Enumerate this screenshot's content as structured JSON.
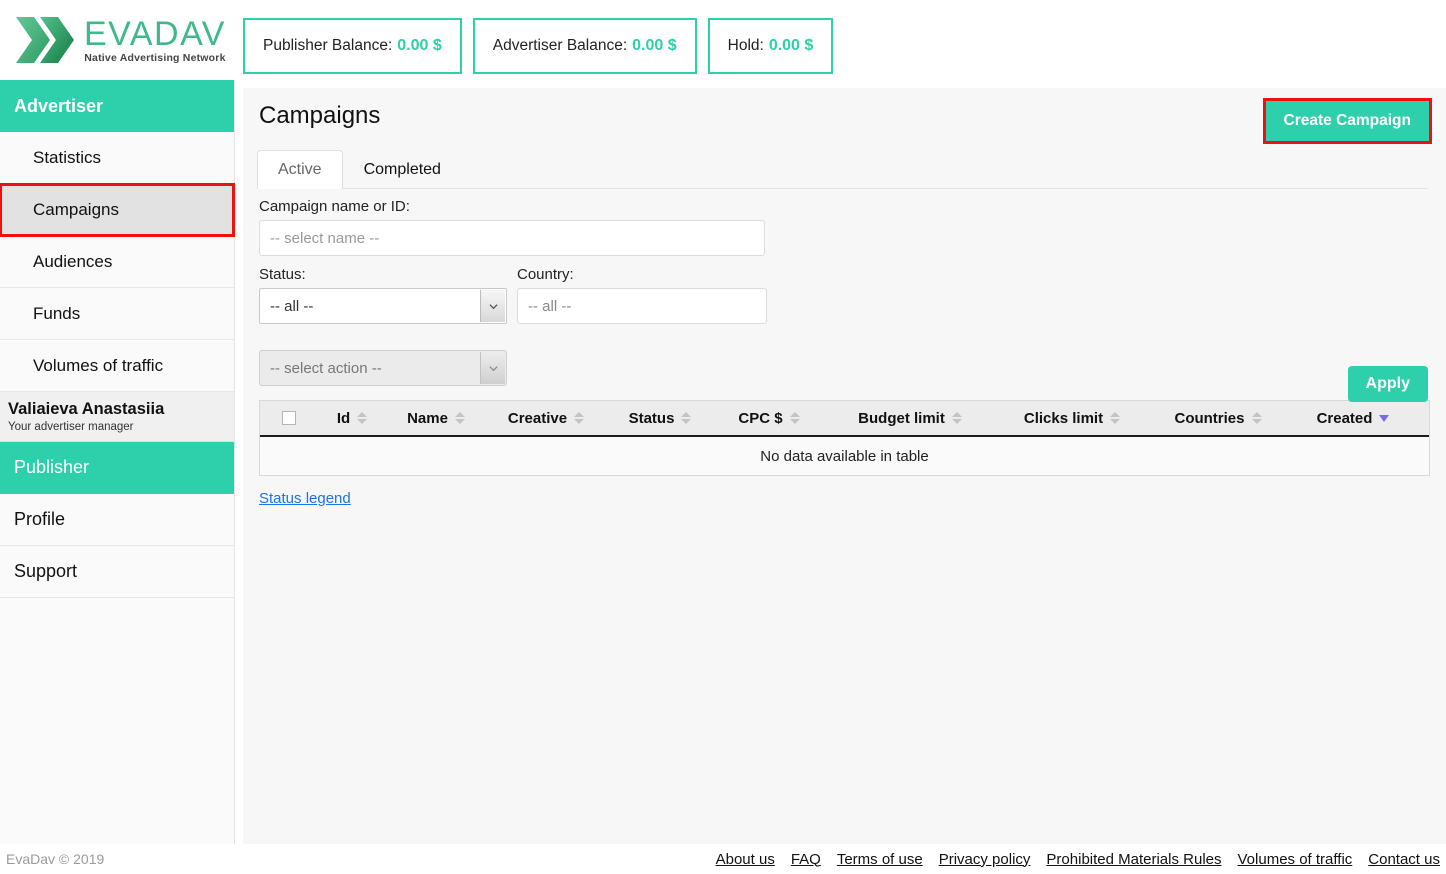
{
  "brand": {
    "name": "EVADAV",
    "tagline": "Native Advertising Network",
    "accent": "#2ecfab",
    "logo_green_dark": "#1f8f5f",
    "logo_green_light": "#5fc88f"
  },
  "balances": [
    {
      "label": "Publisher Balance:",
      "value": "0.00 $"
    },
    {
      "label": "Advertiser Balance:",
      "value": "0.00 $"
    },
    {
      "label": "Hold:",
      "value": "0.00 $"
    }
  ],
  "sidebar": {
    "advertiser_header": "Advertiser",
    "items": [
      {
        "label": "Statistics"
      },
      {
        "label": "Campaigns"
      },
      {
        "label": "Audiences"
      },
      {
        "label": "Funds"
      },
      {
        "label": "Volumes of traffic"
      }
    ],
    "manager": {
      "name": "Valiaieva Anastasiia",
      "role": "Your advertiser manager"
    },
    "publisher_header": "Publisher",
    "bottom_items": [
      {
        "label": "Profile"
      },
      {
        "label": "Support"
      }
    ]
  },
  "main": {
    "page_title": "Campaigns",
    "create_button": "Create Campaign",
    "tabs": [
      {
        "label": "Active",
        "active": true
      },
      {
        "label": "Completed",
        "active": false
      }
    ],
    "filters": {
      "name_label": "Campaign name or ID:",
      "name_placeholder": "-- select name --",
      "status_label": "Status:",
      "status_value": "-- all --",
      "country_label": "Country:",
      "country_placeholder": "-- all --",
      "apply_button": "Apply",
      "action_select_value": "-- select action --"
    },
    "table": {
      "columns": [
        "Id",
        "Name",
        "Creative",
        "Status",
        "CPC $",
        "Budget limit",
        "Clicks limit",
        "Countries",
        "Created"
      ],
      "sorted_column": "Created",
      "sort_direction": "desc",
      "empty_message": "No data available in table"
    },
    "status_legend": "Status legend"
  },
  "footer": {
    "copyright": "EvaDav © 2019",
    "links": [
      "About us",
      "FAQ",
      "Terms of use",
      "Privacy policy",
      "Prohibited Materials Rules",
      "Volumes of traffic",
      "Contact us"
    ]
  }
}
